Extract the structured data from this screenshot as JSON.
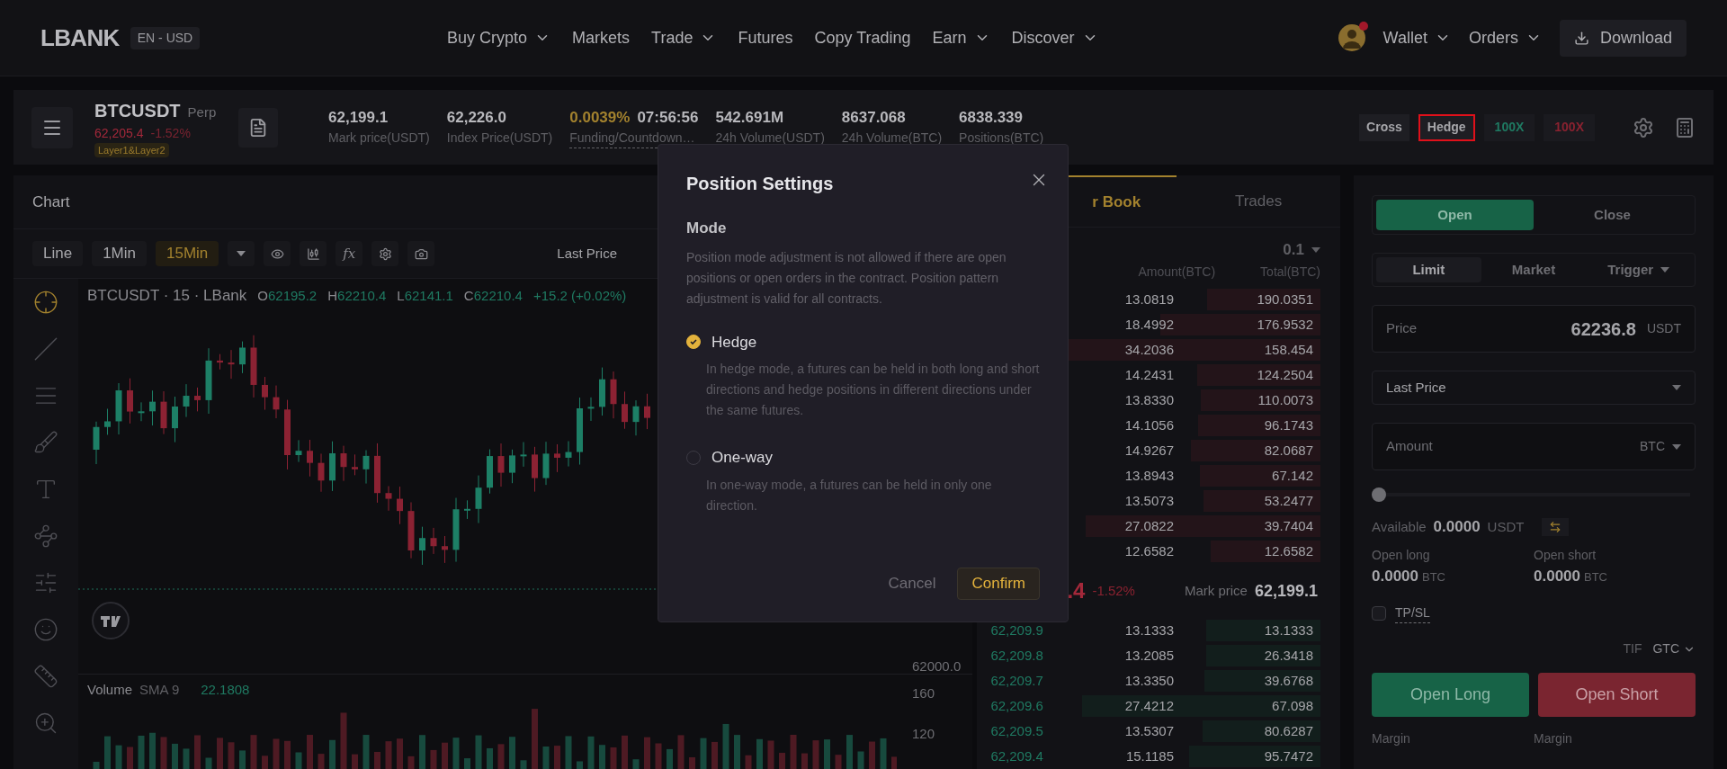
{
  "nav": {
    "logo": "LBANK",
    "locale": "EN - USD",
    "menu": [
      {
        "label": "Buy Crypto",
        "dropdown": true
      },
      {
        "label": "Markets",
        "dropdown": false
      },
      {
        "label": "Trade",
        "dropdown": true
      },
      {
        "label": "Futures",
        "dropdown": false
      },
      {
        "label": "Copy Trading",
        "dropdown": false
      },
      {
        "label": "Earn",
        "dropdown": true
      },
      {
        "label": "Discover",
        "dropdown": true
      }
    ],
    "wallet": "Wallet",
    "orders": "Orders",
    "download": "Download"
  },
  "ticker": {
    "symbol": "BTCUSDT",
    "type": "Perp",
    "price": "62,205.4",
    "change": "-1.52%",
    "tag": "Layer1&Layer2",
    "stats": [
      {
        "kind": "plain",
        "value": "62,199.1",
        "label": "Mark price(USDT)"
      },
      {
        "kind": "plain",
        "value": "62,226.0",
        "label": "Index Price(USDT)"
      },
      {
        "kind": "funding",
        "value": "0.0039%",
        "countdown": "07:56:56",
        "label": "Funding/Countdown…"
      },
      {
        "kind": "plain",
        "value": "542.691M",
        "label": "24h Volume(USDT)"
      },
      {
        "kind": "plain",
        "value": "8637.068",
        "label": "24h Volume(BTC)"
      },
      {
        "kind": "plain",
        "value": "6838.339",
        "label": "Positions(BTC)"
      }
    ],
    "modes": [
      {
        "label": "Cross",
        "highlighted": false
      },
      {
        "label": "Hedge",
        "highlighted": true
      }
    ],
    "leverage": [
      {
        "label": "100X",
        "kind": "long"
      },
      {
        "label": "100X",
        "kind": "short"
      }
    ]
  },
  "chart": {
    "title": "Chart",
    "intervals": [
      {
        "label": "Line",
        "selected": false
      },
      {
        "label": "1Min",
        "selected": false
      },
      {
        "label": "15Min",
        "selected": true
      }
    ],
    "indicator": "fx",
    "price_source": "Last Price",
    "legend": "BTCUSDT · 15 · LBank",
    "ohlc": [
      {
        "key": "O",
        "value": "62195.2"
      },
      {
        "key": "H",
        "value": "62210.4"
      },
      {
        "key": "L",
        "value": "62141.1"
      },
      {
        "key": "C",
        "value": "62210.4"
      }
    ],
    "change": "+15.2 (+0.02%)",
    "price_axis": [
      "62000.0"
    ],
    "volume_label": "Volume",
    "volume_indicator": "SMA 9",
    "volume_value": "22.1808",
    "volume_axis": [
      "160",
      "120"
    ]
  },
  "order_book": {
    "tabs": [
      {
        "label": "r Book",
        "selected": true
      },
      {
        "label": "Trades",
        "selected": false
      }
    ],
    "precision": "0.1",
    "columns": [
      "Amount(BTC)",
      "Total(BTC)"
    ],
    "asks": [
      {
        "amount": "13.0819",
        "total": "190.0351"
      },
      {
        "amount": "18.4992",
        "total": "176.9532"
      },
      {
        "amount": "34.2036",
        "total": "158.454"
      },
      {
        "amount": "14.2431",
        "total": "124.2504"
      },
      {
        "amount": "13.8330",
        "total": "110.0073"
      },
      {
        "amount": "14.1056",
        "total": "96.1743"
      },
      {
        "amount": "14.9267",
        "total": "82.0687"
      },
      {
        "amount": "13.8943",
        "total": "67.142"
      },
      {
        "amount": "13.5073",
        "total": "53.2477"
      },
      {
        "amount": "27.0822",
        "total": "39.7404"
      },
      {
        "amount": "12.6582",
        "total": "12.6582"
      }
    ],
    "last_price": ".4",
    "last_change": "-1.52%",
    "mark_label": "Mark price",
    "mark_price": "62,199.1",
    "bids": [
      {
        "price": "62,209.9",
        "amount": "13.1333",
        "total": "13.1333"
      },
      {
        "price": "62,209.8",
        "amount": "13.2085",
        "total": "26.3418"
      },
      {
        "price": "62,209.7",
        "amount": "13.3350",
        "total": "39.6768"
      },
      {
        "price": "62,209.6",
        "amount": "27.4212",
        "total": "67.098"
      },
      {
        "price": "62,209.5",
        "amount": "13.5307",
        "total": "80.6287"
      },
      {
        "price": "62,209.4",
        "amount": "15.1185",
        "total": "95.7472"
      }
    ]
  },
  "order_form": {
    "sides": [
      {
        "label": "Open",
        "selected": true
      },
      {
        "label": "Close",
        "selected": false
      }
    ],
    "types": [
      {
        "label": "Limit",
        "selected": true,
        "dropdown": false
      },
      {
        "label": "Market",
        "selected": false,
        "dropdown": false
      },
      {
        "label": "Trigger",
        "selected": false,
        "dropdown": true
      }
    ],
    "price": {
      "label": "Price",
      "value": "62236.8",
      "unit": "USDT"
    },
    "price_type": "Last Price",
    "amount": {
      "placeholder": "Amount",
      "unit": "BTC"
    },
    "slider": {
      "level": 0
    },
    "available": {
      "label": "Available",
      "value": "0.0000",
      "unit": "USDT"
    },
    "open_stats": [
      {
        "label": "Open long",
        "value": "0.0000",
        "unit": "BTC"
      },
      {
        "label": "Open short",
        "value": "0.0000",
        "unit": "BTC"
      }
    ],
    "tpsl": {
      "label": "TP/SL",
      "checked": false
    },
    "tif": {
      "label": "TIF",
      "value": "GTC"
    },
    "actions": [
      {
        "label": "Open Long",
        "kind": "long"
      },
      {
        "label": "Open Short",
        "kind": "short"
      }
    ],
    "margins": [
      "Margin",
      "Margin"
    ]
  },
  "dialog": {
    "title": "Position Settings",
    "section": "Mode",
    "note": "Position mode adjustment is not allowed if there are open positions or open orders in the contract. Position pattern adjustment is valid for all contracts.",
    "options": [
      {
        "label": "Hedge",
        "description": "In hedge mode, a futures can be held in both long and short directions and hedge positions in different directions under the same futures.",
        "selected": true
      },
      {
        "label": "One-way",
        "description": "In one-way mode, a futures can be held in only one direction.",
        "selected": false
      }
    ],
    "cancel": "Cancel",
    "confirm": "Confirm"
  }
}
